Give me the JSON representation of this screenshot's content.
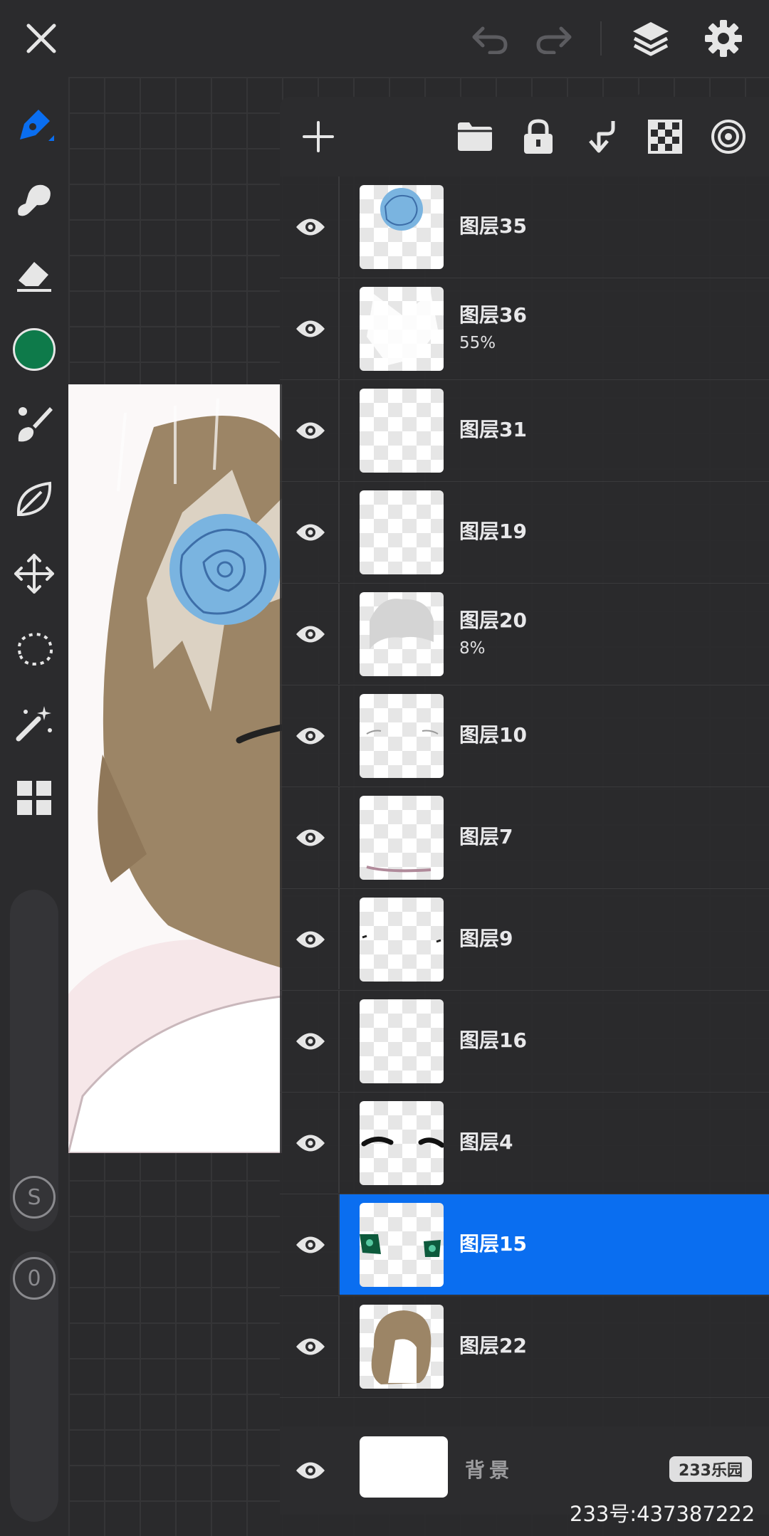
{
  "app": {
    "accent_color": "#0a6ef0",
    "current_color": "#0e7a4a"
  },
  "topbar": {
    "icons": [
      "close-icon",
      "undo-icon",
      "redo-icon",
      "layers-icon",
      "settings-icon"
    ]
  },
  "sidebar": {
    "tools": [
      "pen-icon",
      "smudge-icon",
      "eraser-icon",
      "color-swatch",
      "brush-icon",
      "leaf-icon",
      "transform-icon",
      "lasso-icon",
      "magic-wand-icon",
      "grid-icon"
    ],
    "size_slider_label": "S",
    "opacity_slider_label": "0"
  },
  "layers_panel": {
    "toolbar_icons": [
      "add-icon",
      "folder-icon",
      "lock-icon",
      "merge-down-icon",
      "checkerboard-icon",
      "target-icon"
    ],
    "layers": [
      {
        "name": "图层35",
        "opacity": "",
        "selected": false,
        "visible": true
      },
      {
        "name": "图层36",
        "opacity": "55%",
        "selected": false,
        "visible": true
      },
      {
        "name": "图层31",
        "opacity": "",
        "selected": false,
        "visible": true
      },
      {
        "name": "图层19",
        "opacity": "",
        "selected": false,
        "visible": true
      },
      {
        "name": "图层20",
        "opacity": "8%",
        "selected": false,
        "visible": true
      },
      {
        "name": "图层10",
        "opacity": "",
        "selected": false,
        "visible": true
      },
      {
        "name": "图层7",
        "opacity": "",
        "selected": false,
        "visible": true
      },
      {
        "name": "图层9",
        "opacity": "",
        "selected": false,
        "visible": true
      },
      {
        "name": "图层16",
        "opacity": "",
        "selected": false,
        "visible": true
      },
      {
        "name": "图层4",
        "opacity": "",
        "selected": false,
        "visible": true
      },
      {
        "name": "图层15",
        "opacity": "",
        "selected": true,
        "visible": true
      },
      {
        "name": "图层22",
        "opacity": "",
        "selected": false,
        "visible": true
      }
    ],
    "background_layer": {
      "name": "背景",
      "visible": true
    }
  },
  "watermark": {
    "logo_text": "233乐园",
    "id_text": "233号:437387222"
  }
}
